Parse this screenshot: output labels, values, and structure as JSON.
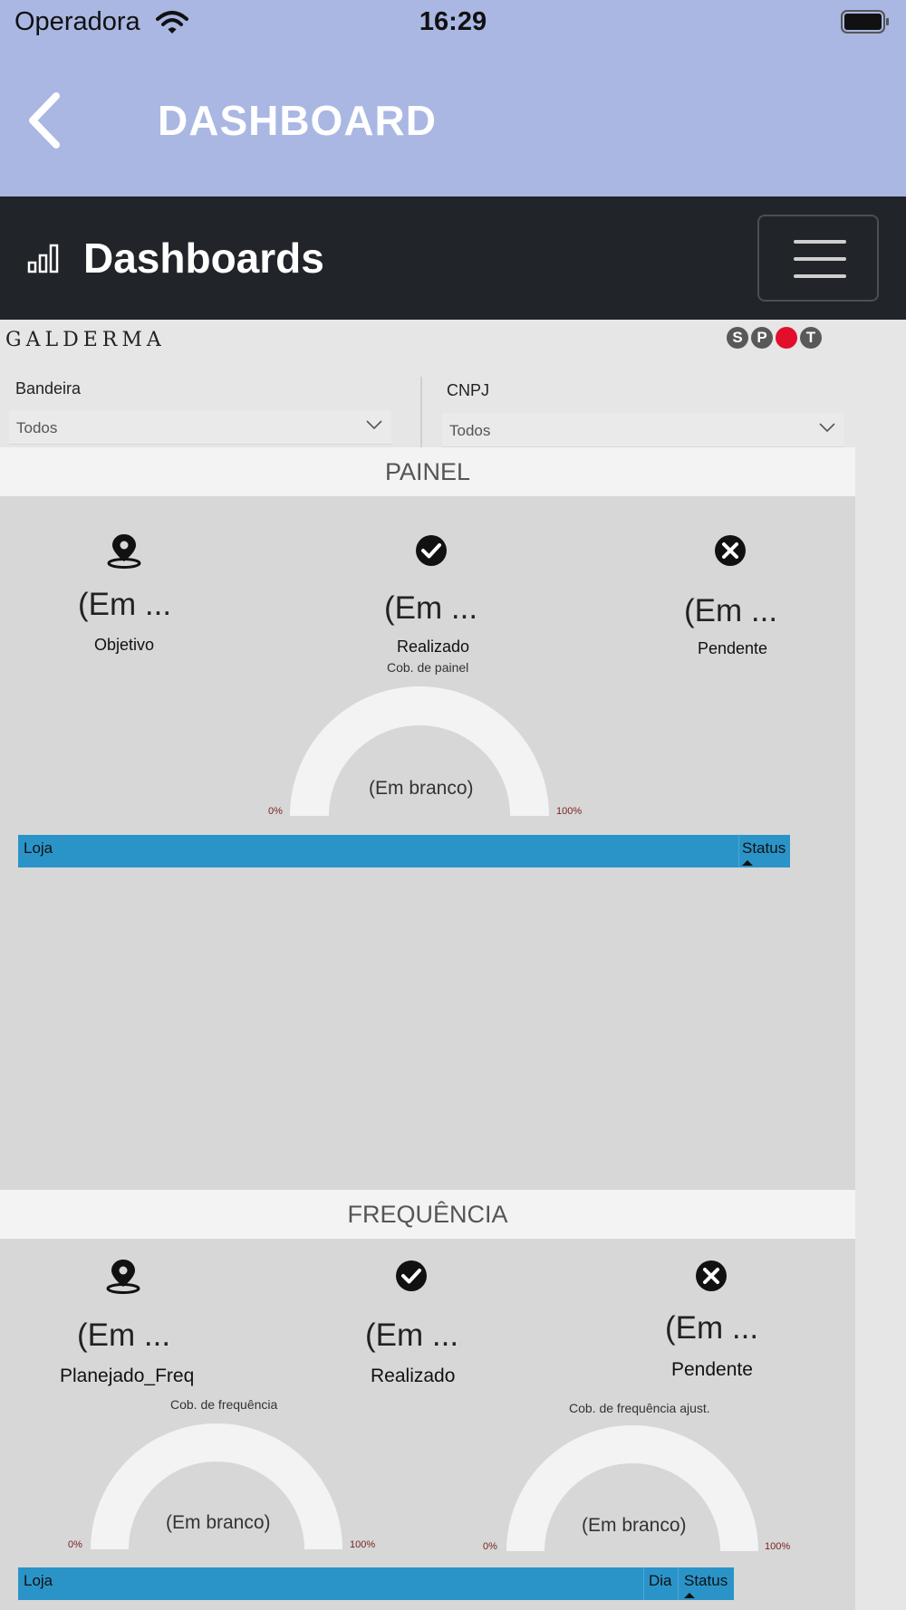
{
  "status_bar": {
    "carrier": "Operadora",
    "time": "16:29"
  },
  "app_bar": {
    "title": "DASHBOARD"
  },
  "header": {
    "title": "Dashboards"
  },
  "logos": {
    "left": "GALDERMA",
    "right_letters": [
      "S",
      "P",
      "",
      "T"
    ]
  },
  "filters": [
    {
      "label": "Bandeira",
      "value": "Todos"
    },
    {
      "label": "CNPJ",
      "value": "Todos"
    }
  ],
  "painel": {
    "title": "PAINEL",
    "kpis": [
      {
        "icon": "map-pin-icon",
        "value": "(Em ...",
        "label": "Objetivo"
      },
      {
        "icon": "check-circle-icon",
        "value": "(Em ...",
        "label": "Realizado"
      },
      {
        "icon": "x-circle-icon",
        "value": "(Em ...",
        "label": "Pendente"
      }
    ],
    "gauge": {
      "title": "Cob. de painel",
      "value_text": "(Em branco)",
      "min_label": "0%",
      "max_label": "100%"
    },
    "table": {
      "columns": [
        "Loja",
        "Status"
      ]
    }
  },
  "frequencia": {
    "title": "FREQUÊNCIA",
    "kpis": [
      {
        "icon": "map-pin-icon",
        "value": "(Em ...",
        "label": "Planejado_Freq"
      },
      {
        "icon": "check-circle-icon",
        "value": "(Em ...",
        "label": "Realizado"
      },
      {
        "icon": "x-circle-icon",
        "value": "(Em ...",
        "label": "Pendente"
      }
    ],
    "gauges": [
      {
        "title": "Cob. de frequência",
        "value_text": "(Em branco)",
        "min_label": "0%",
        "max_label": "100%"
      },
      {
        "title": "Cob. de frequência ajust.",
        "value_text": "(Em branco)",
        "min_label": "0%",
        "max_label": "100%"
      }
    ],
    "table": {
      "columns": [
        "Loja",
        "Dia",
        "Status"
      ]
    }
  },
  "colors": {
    "app_bar": "#a9b7e2",
    "header": "#212429",
    "table_header": "#2a94c9",
    "section_bg": "#d7d7d7",
    "spot_red": "#e30e2c"
  }
}
